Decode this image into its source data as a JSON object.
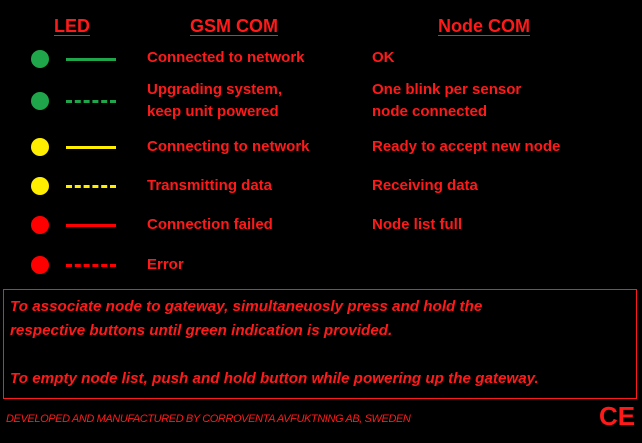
{
  "colors": {
    "background": "#000000",
    "text": "#ff1a1a",
    "green": "#1fa64a",
    "yellow": "#ffee00",
    "red": "#ff0000"
  },
  "headers": {
    "led": "LED",
    "gsm": "GSM COM",
    "node": "Node COM"
  },
  "rows": [
    {
      "color": "green",
      "style": "solid",
      "gsm": [
        "Connected to network"
      ],
      "node": [
        "OK"
      ]
    },
    {
      "color": "green",
      "style": "dashed",
      "gsm": [
        "Upgrading system,",
        "keep unit powered"
      ],
      "node": [
        "One blink per sensor",
        "node connected"
      ]
    },
    {
      "color": "yellow",
      "style": "solid",
      "gsm": [
        "Connecting to network"
      ],
      "node": [
        "Ready to accept new node"
      ]
    },
    {
      "color": "yellow",
      "style": "dashed",
      "gsm": [
        "Transmitting data"
      ],
      "node": [
        "Receiving data"
      ]
    },
    {
      "color": "red",
      "style": "solid",
      "gsm": [
        "Connection failed"
      ],
      "node": [
        "Node list full"
      ]
    },
    {
      "color": "red",
      "style": "dashed",
      "gsm": [
        "Error"
      ],
      "node": []
    }
  ],
  "notes": [
    "To associate node to gateway, simultaneuosly press and hold the",
    "respective buttons until green indication is provided.",
    "To empty node list, push and hold button while powering up the gateway."
  ],
  "footer": "DEVELOPED AND MANUFACTURED BY CORROVENTA AVFUKTNING AB, SWEDEN",
  "ce_mark": "CE"
}
